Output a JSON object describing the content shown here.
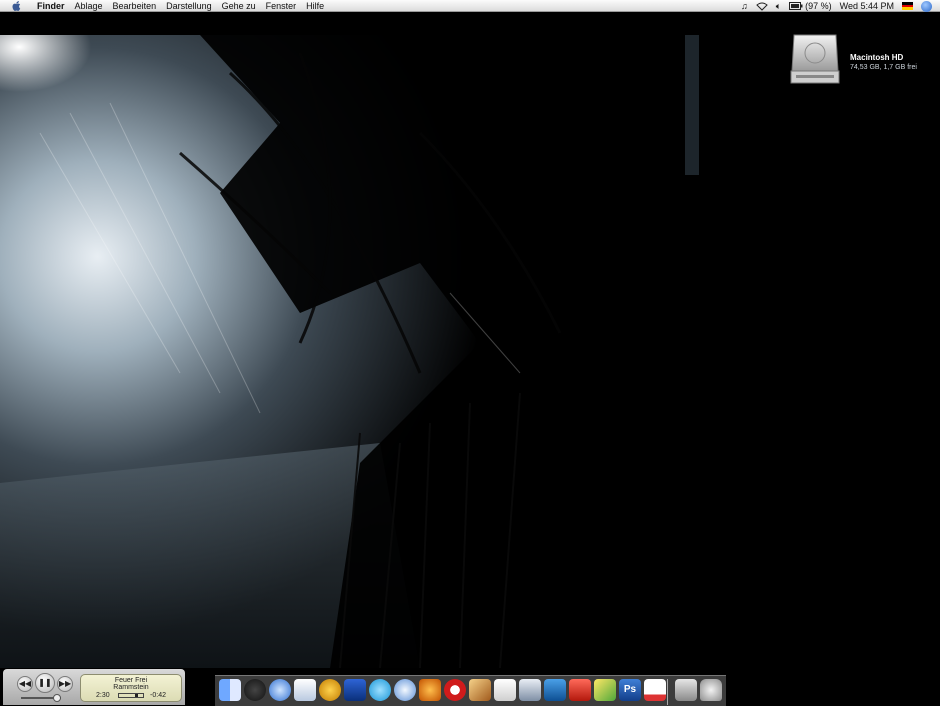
{
  "menubar": {
    "apple_icon": "apple-icon",
    "items": [
      "Finder",
      "Ablage",
      "Bearbeiten",
      "Darstellung",
      "Gehe zu",
      "Fenster",
      "Hilfe"
    ],
    "battery": "(97 %)",
    "clock": "Wed 5:44 PM",
    "status_icons": [
      "music-note-icon",
      "wifi-icon",
      "volume-icon",
      "battery-icon",
      "flag-de-icon",
      "spotlight-icon"
    ]
  },
  "desktop": {
    "drive": {
      "name": "Macintosh HD",
      "info": "74,53 GB, 1,7 GB frei",
      "icon": "hard-drive-icon"
    }
  },
  "itunes": {
    "track": "Feuer Frei",
    "artist": "Rammstein",
    "elapsed": "2:30",
    "remaining": "-0:42",
    "progress": 0.78,
    "buttons": [
      "previous-icon",
      "pause-icon",
      "next-icon"
    ]
  },
  "dock": {
    "apps": [
      "finder-icon",
      "dashboard-icon",
      "safari-icon",
      "preview-icon",
      "fetch-icon",
      "bluetooth-icon",
      "skype-icon",
      "itunes-icon",
      "rapidweaver-icon",
      "real-player-icon",
      "garageband-icon",
      "textedit-icon",
      "script-editor-icon",
      "dreamweaver-icon",
      "toolbox-icon",
      "photo-icon",
      "photoshop-icon",
      "calendar-icon",
      "minimized-window-icon",
      "trash-icon"
    ],
    "colors": {
      "accent": "#2a66c8",
      "menubar": "#e8e8e8",
      "lcd": "#e9e8c4"
    }
  }
}
